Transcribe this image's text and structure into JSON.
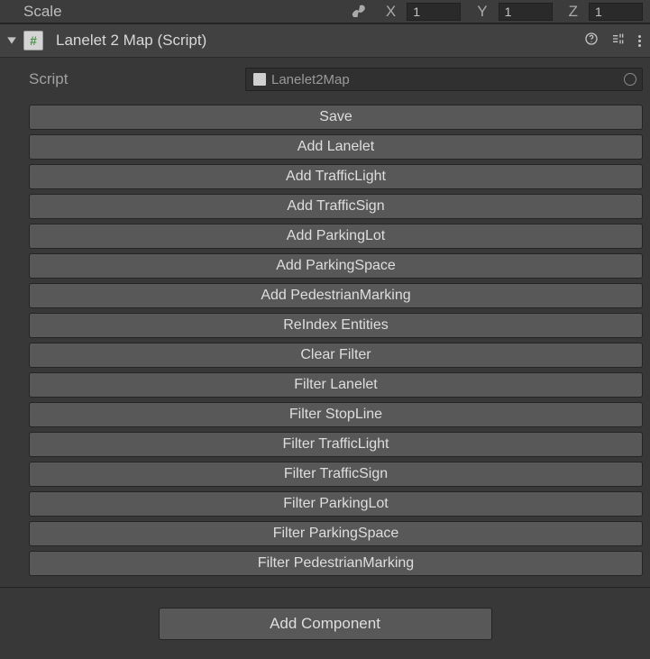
{
  "scaleRow": {
    "label": "Scale",
    "x": "1",
    "y": "1",
    "z": "1"
  },
  "component": {
    "title": "Lanelet 2 Map (Script)",
    "scriptField": {
      "label": "Script",
      "value": "Lanelet2Map"
    },
    "buttons": [
      "Save",
      "Add Lanelet",
      "Add TrafficLight",
      "Add TrafficSign",
      "Add ParkingLot",
      "Add ParkingSpace",
      "Add PedestrianMarking",
      "ReIndex Entities",
      "Clear Filter",
      "Filter Lanelet",
      "Filter StopLine",
      "Filter TrafficLight",
      "Filter TrafficSign",
      "Filter ParkingLot",
      "Filter ParkingSpace",
      "Filter PedestrianMarking"
    ]
  },
  "footer": {
    "addComponent": "Add Component"
  }
}
